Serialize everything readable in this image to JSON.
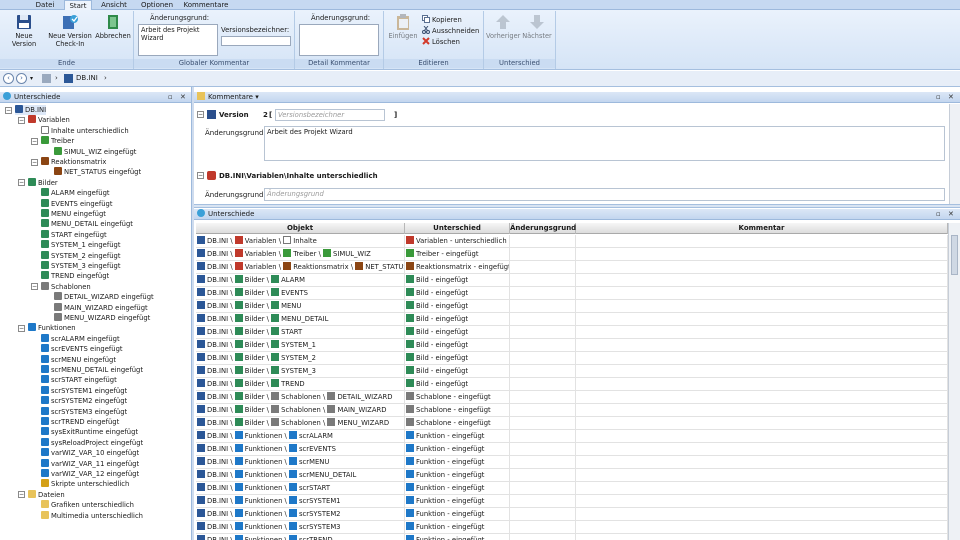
{
  "tabs": [
    {
      "label": "Datei",
      "active": false
    },
    {
      "label": "Start",
      "active": true
    },
    {
      "label": "Ansicht",
      "active": false
    },
    {
      "label": "Optionen",
      "active": false
    },
    {
      "label": "Kommentare",
      "active": false
    }
  ],
  "ribbon": {
    "ende": {
      "label": "Ende",
      "new_version": "Neue Version",
      "new_version_checkin": "Neue Version Check-In",
      "abbrechen": "Abbrechen"
    },
    "global": {
      "label": "Globaler Kommentar",
      "reason_label": "Änderungsgrund:",
      "reason_value": "Arbeit des Projekt Wizard",
      "version_label": "Versionsbezeichner:",
      "version_value": ""
    },
    "detail": {
      "label": "Detail Kommentar",
      "reason_label": "Änderungsgrund:",
      "reason_value": ""
    },
    "edit": {
      "label": "Editieren",
      "paste": "Einfügen",
      "copy": "Kopieren",
      "cut": "Ausschneiden",
      "delete": "Löschen"
    },
    "diff": {
      "label": "Unterschied",
      "prev": "Vorheriger",
      "next": "Nächster"
    }
  },
  "address": {
    "path": "DB.INI"
  },
  "left_pane": {
    "title": "Unterschiede",
    "tree": [
      {
        "label": "DB.INI",
        "level": 0,
        "icon": "db",
        "exp": "-"
      },
      {
        "label": "Variablen",
        "level": 1,
        "icon": "var",
        "exp": "-"
      },
      {
        "label": "Inhalte unterschiedlich",
        "level": 2,
        "icon": "doc",
        "exp": ""
      },
      {
        "label": "Treiber",
        "level": 2,
        "icon": "drv",
        "exp": "-"
      },
      {
        "label": "SIMUL_WIZ eingefügt",
        "level": 3,
        "icon": "drv",
        "exp": ""
      },
      {
        "label": "Reaktionsmatrix",
        "level": 2,
        "icon": "mat",
        "exp": "-"
      },
      {
        "label": "NET_STATUS eingefügt",
        "level": 3,
        "icon": "mat",
        "exp": ""
      },
      {
        "label": "Bilder",
        "level": 1,
        "icon": "pic",
        "exp": "-"
      },
      {
        "label": "ALARM eingefügt",
        "level": 2,
        "icon": "pic",
        "exp": ""
      },
      {
        "label": "EVENTS eingefügt",
        "level": 2,
        "icon": "pic",
        "exp": ""
      },
      {
        "label": "MENU eingefügt",
        "level": 2,
        "icon": "pic",
        "exp": ""
      },
      {
        "label": "MENU_DETAIL eingefügt",
        "level": 2,
        "icon": "pic",
        "exp": ""
      },
      {
        "label": "START eingefügt",
        "level": 2,
        "icon": "pic",
        "exp": ""
      },
      {
        "label": "SYSTEM_1 eingefügt",
        "level": 2,
        "icon": "pic",
        "exp": ""
      },
      {
        "label": "SYSTEM_2 eingefügt",
        "level": 2,
        "icon": "pic",
        "exp": ""
      },
      {
        "label": "SYSTEM_3 eingefügt",
        "level": 2,
        "icon": "pic",
        "exp": ""
      },
      {
        "label": "TREND eingefügt",
        "level": 2,
        "icon": "pic",
        "exp": ""
      },
      {
        "label": "Schablonen",
        "level": 2,
        "icon": "tpl",
        "exp": "-"
      },
      {
        "label": "DETAIL_WIZARD eingefügt",
        "level": 3,
        "icon": "tpl",
        "exp": ""
      },
      {
        "label": "MAIN_WIZARD eingefügt",
        "level": 3,
        "icon": "tpl",
        "exp": ""
      },
      {
        "label": "MENU_WIZARD eingefügt",
        "level": 3,
        "icon": "tpl",
        "exp": ""
      },
      {
        "label": "Funktionen",
        "level": 1,
        "icon": "fn",
        "exp": "-"
      },
      {
        "label": "scrALARM eingefügt",
        "level": 2,
        "icon": "fn",
        "exp": ""
      },
      {
        "label": "scrEVENTS eingefügt",
        "level": 2,
        "icon": "fn",
        "exp": ""
      },
      {
        "label": "scrMENU eingefügt",
        "level": 2,
        "icon": "fn",
        "exp": ""
      },
      {
        "label": "scrMENU_DETAIL eingefügt",
        "level": 2,
        "icon": "fn",
        "exp": ""
      },
      {
        "label": "scrSTART eingefügt",
        "level": 2,
        "icon": "fn",
        "exp": ""
      },
      {
        "label": "scrSYSTEM1 eingefügt",
        "level": 2,
        "icon": "fn",
        "exp": ""
      },
      {
        "label": "scrSYSTEM2 eingefügt",
        "level": 2,
        "icon": "fn",
        "exp": ""
      },
      {
        "label": "scrSYSTEM3 eingefügt",
        "level": 2,
        "icon": "fn",
        "exp": ""
      },
      {
        "label": "scrTREND eingefügt",
        "level": 2,
        "icon": "fn",
        "exp": ""
      },
      {
        "label": "sysExitRuntime eingefügt",
        "level": 2,
        "icon": "fn",
        "exp": ""
      },
      {
        "label": "sysReloadProject eingefügt",
        "level": 2,
        "icon": "fn",
        "exp": ""
      },
      {
        "label": "varWIZ_VAR_10 eingefügt",
        "level": 2,
        "icon": "fn",
        "exp": ""
      },
      {
        "label": "varWIZ_VAR_11 eingefügt",
        "level": 2,
        "icon": "fn",
        "exp": ""
      },
      {
        "label": "varWIZ_VAR_12 eingefügt",
        "level": 2,
        "icon": "fn",
        "exp": ""
      },
      {
        "label": "Skripte unterschiedlich",
        "level": 2,
        "icon": "scr",
        "exp": ""
      },
      {
        "label": "Dateien",
        "level": 1,
        "icon": "fld",
        "exp": "-"
      },
      {
        "label": "Grafiken unterschiedlich",
        "level": 2,
        "icon": "fld",
        "exp": ""
      },
      {
        "label": "Multimedia unterschiedlich",
        "level": 2,
        "icon": "fld",
        "exp": ""
      }
    ]
  },
  "comments": {
    "title": "Kommentare",
    "version_label": "Version",
    "version_num": "2",
    "version_bracket_open": "[",
    "version_bracket_close": "]",
    "version_placeholder": "Versionsbezeichner",
    "reason_label": "Änderungsgrund:",
    "reason_value": "Arbeit des Projekt Wizard",
    "detail_path": "DB.INI\\Variablen\\Inhalte unterschiedlich",
    "detail_reason_label": "Änderungsgrund:",
    "detail_reason_placeholder": "Änderungsgrund"
  },
  "diffs": {
    "title": "Unterschiede",
    "columns": [
      "Objekt",
      "Unterschied",
      "Änderungsgrund",
      "Kommentar"
    ],
    "rows": [
      {
        "path": [
          [
            "db",
            "DB.INI"
          ],
          [
            "var",
            "Variablen"
          ],
          [
            "doc",
            "Inhalte"
          ]
        ],
        "icon": "var",
        "diff": "Variablen - unterschiedlich"
      },
      {
        "path": [
          [
            "db",
            "DB.INI"
          ],
          [
            "var",
            "Variablen"
          ],
          [
            "drv",
            "Treiber"
          ],
          [
            "drv",
            "SIMUL_WIZ"
          ]
        ],
        "icon": "drv",
        "diff": "Treiber - eingefügt"
      },
      {
        "path": [
          [
            "db",
            "DB.INI"
          ],
          [
            "var",
            "Variablen"
          ],
          [
            "mat",
            "Reaktionsmatrix"
          ],
          [
            "mat",
            "NET_STATUS"
          ]
        ],
        "icon": "mat",
        "diff": "Reaktionsmatrix - eingefügt"
      },
      {
        "path": [
          [
            "db",
            "DB.INI"
          ],
          [
            "pic",
            "Bilder"
          ],
          [
            "pic",
            "ALARM"
          ]
        ],
        "icon": "pic",
        "diff": "Bild - eingefügt"
      },
      {
        "path": [
          [
            "db",
            "DB.INI"
          ],
          [
            "pic",
            "Bilder"
          ],
          [
            "pic",
            "EVENTS"
          ]
        ],
        "icon": "pic",
        "diff": "Bild - eingefügt"
      },
      {
        "path": [
          [
            "db",
            "DB.INI"
          ],
          [
            "pic",
            "Bilder"
          ],
          [
            "pic",
            "MENU"
          ]
        ],
        "icon": "pic",
        "diff": "Bild - eingefügt"
      },
      {
        "path": [
          [
            "db",
            "DB.INI"
          ],
          [
            "pic",
            "Bilder"
          ],
          [
            "pic",
            "MENU_DETAIL"
          ]
        ],
        "icon": "pic",
        "diff": "Bild - eingefügt"
      },
      {
        "path": [
          [
            "db",
            "DB.INI"
          ],
          [
            "pic",
            "Bilder"
          ],
          [
            "pic",
            "START"
          ]
        ],
        "icon": "pic",
        "diff": "Bild - eingefügt"
      },
      {
        "path": [
          [
            "db",
            "DB.INI"
          ],
          [
            "pic",
            "Bilder"
          ],
          [
            "pic",
            "SYSTEM_1"
          ]
        ],
        "icon": "pic",
        "diff": "Bild - eingefügt"
      },
      {
        "path": [
          [
            "db",
            "DB.INI"
          ],
          [
            "pic",
            "Bilder"
          ],
          [
            "pic",
            "SYSTEM_2"
          ]
        ],
        "icon": "pic",
        "diff": "Bild - eingefügt"
      },
      {
        "path": [
          [
            "db",
            "DB.INI"
          ],
          [
            "pic",
            "Bilder"
          ],
          [
            "pic",
            "SYSTEM_3"
          ]
        ],
        "icon": "pic",
        "diff": "Bild - eingefügt"
      },
      {
        "path": [
          [
            "db",
            "DB.INI"
          ],
          [
            "pic",
            "Bilder"
          ],
          [
            "pic",
            "TREND"
          ]
        ],
        "icon": "pic",
        "diff": "Bild - eingefügt"
      },
      {
        "path": [
          [
            "db",
            "DB.INI"
          ],
          [
            "pic",
            "Bilder"
          ],
          [
            "tpl",
            "Schablonen"
          ],
          [
            "tpl",
            "DETAIL_WIZARD"
          ]
        ],
        "icon": "tpl",
        "diff": "Schablone - eingefügt"
      },
      {
        "path": [
          [
            "db",
            "DB.INI"
          ],
          [
            "pic",
            "Bilder"
          ],
          [
            "tpl",
            "Schablonen"
          ],
          [
            "tpl",
            "MAIN_WIZARD"
          ]
        ],
        "icon": "tpl",
        "diff": "Schablone - eingefügt"
      },
      {
        "path": [
          [
            "db",
            "DB.INI"
          ],
          [
            "pic",
            "Bilder"
          ],
          [
            "tpl",
            "Schablonen"
          ],
          [
            "tpl",
            "MENU_WIZARD"
          ]
        ],
        "icon": "tpl",
        "diff": "Schablone - eingefügt"
      },
      {
        "path": [
          [
            "db",
            "DB.INI"
          ],
          [
            "fn",
            "Funktionen"
          ],
          [
            "fn",
            "scrALARM"
          ]
        ],
        "icon": "fn",
        "diff": "Funktion - eingefügt"
      },
      {
        "path": [
          [
            "db",
            "DB.INI"
          ],
          [
            "fn",
            "Funktionen"
          ],
          [
            "fn",
            "scrEVENTS"
          ]
        ],
        "icon": "fn",
        "diff": "Funktion - eingefügt"
      },
      {
        "path": [
          [
            "db",
            "DB.INI"
          ],
          [
            "fn",
            "Funktionen"
          ],
          [
            "fn",
            "scrMENU"
          ]
        ],
        "icon": "fn",
        "diff": "Funktion - eingefügt"
      },
      {
        "path": [
          [
            "db",
            "DB.INI"
          ],
          [
            "fn",
            "Funktionen"
          ],
          [
            "fn",
            "scrMENU_DETAIL"
          ]
        ],
        "icon": "fn",
        "diff": "Funktion - eingefügt"
      },
      {
        "path": [
          [
            "db",
            "DB.INI"
          ],
          [
            "fn",
            "Funktionen"
          ],
          [
            "fn",
            "scrSTART"
          ]
        ],
        "icon": "fn",
        "diff": "Funktion - eingefügt"
      },
      {
        "path": [
          [
            "db",
            "DB.INI"
          ],
          [
            "fn",
            "Funktionen"
          ],
          [
            "fn",
            "scrSYSTEM1"
          ]
        ],
        "icon": "fn",
        "diff": "Funktion - eingefügt"
      },
      {
        "path": [
          [
            "db",
            "DB.INI"
          ],
          [
            "fn",
            "Funktionen"
          ],
          [
            "fn",
            "scrSYSTEM2"
          ]
        ],
        "icon": "fn",
        "diff": "Funktion - eingefügt"
      },
      {
        "path": [
          [
            "db",
            "DB.INI"
          ],
          [
            "fn",
            "Funktionen"
          ],
          [
            "fn",
            "scrSYSTEM3"
          ]
        ],
        "icon": "fn",
        "diff": "Funktion - eingefügt"
      },
      {
        "path": [
          [
            "db",
            "DB.INI"
          ],
          [
            "fn",
            "Funktionen"
          ],
          [
            "fn",
            "scrTREND"
          ]
        ],
        "icon": "fn",
        "diff": "Funktion - eingefügt"
      }
    ]
  },
  "icon_colors": {
    "db": "#2b5797",
    "var": "#c0392b",
    "doc": "#ffffff",
    "drv": "#3a9a3a",
    "mat": "#8b4513",
    "pic": "#2e8b57",
    "tpl": "#7a7a7a",
    "fn": "#1e78c8",
    "scr": "#d4a017",
    "fld": "#e8c35a"
  }
}
